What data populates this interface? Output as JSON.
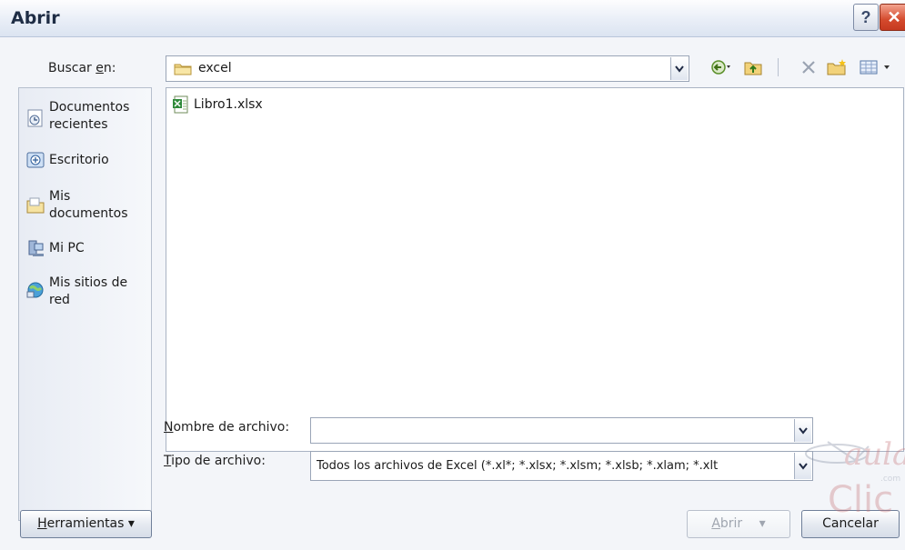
{
  "window": {
    "title": "Abrir",
    "help_glyph": "?",
    "close_glyph": "✕"
  },
  "lookin": {
    "label_pre": "Buscar ",
    "label_key": "e",
    "label_post": "n:",
    "value": "excel"
  },
  "toolbar": {
    "icons": [
      "back-icon",
      "up-folder-icon",
      "delete-icon",
      "new-folder-icon",
      "views-icon"
    ]
  },
  "places": [
    {
      "label": "Documentos recientes",
      "icon": "recent-documents-icon"
    },
    {
      "label": "Escritorio",
      "icon": "desktop-icon"
    },
    {
      "label": "Mis documentos",
      "icon": "my-documents-icon"
    },
    {
      "label": "Mi PC",
      "icon": "my-computer-icon"
    },
    {
      "label": "Mis sitios de red",
      "icon": "network-places-icon"
    }
  ],
  "files": [
    {
      "name": "Libro1.xlsx",
      "icon": "excel-file-icon"
    }
  ],
  "filename": {
    "label_key": "N",
    "label_rest": "ombre de archivo:",
    "value": ""
  },
  "filetype": {
    "label_key": "T",
    "label_rest": "ipo de archivo:",
    "value": "Todos los archivos de Excel (*.xl*; *.xlsx; *.xlsm; *.xlsb; *.xlam; *.xlt"
  },
  "buttons": {
    "tools_key": "H",
    "tools_rest": "erramientas",
    "tools_arrow": "▾",
    "open_key": "A",
    "open_rest": "brir",
    "open_arrow": "▾",
    "cancel": "Cancelar"
  },
  "colors": {
    "accent": "#d44a2d",
    "window_bg": "#f3f5f9"
  }
}
